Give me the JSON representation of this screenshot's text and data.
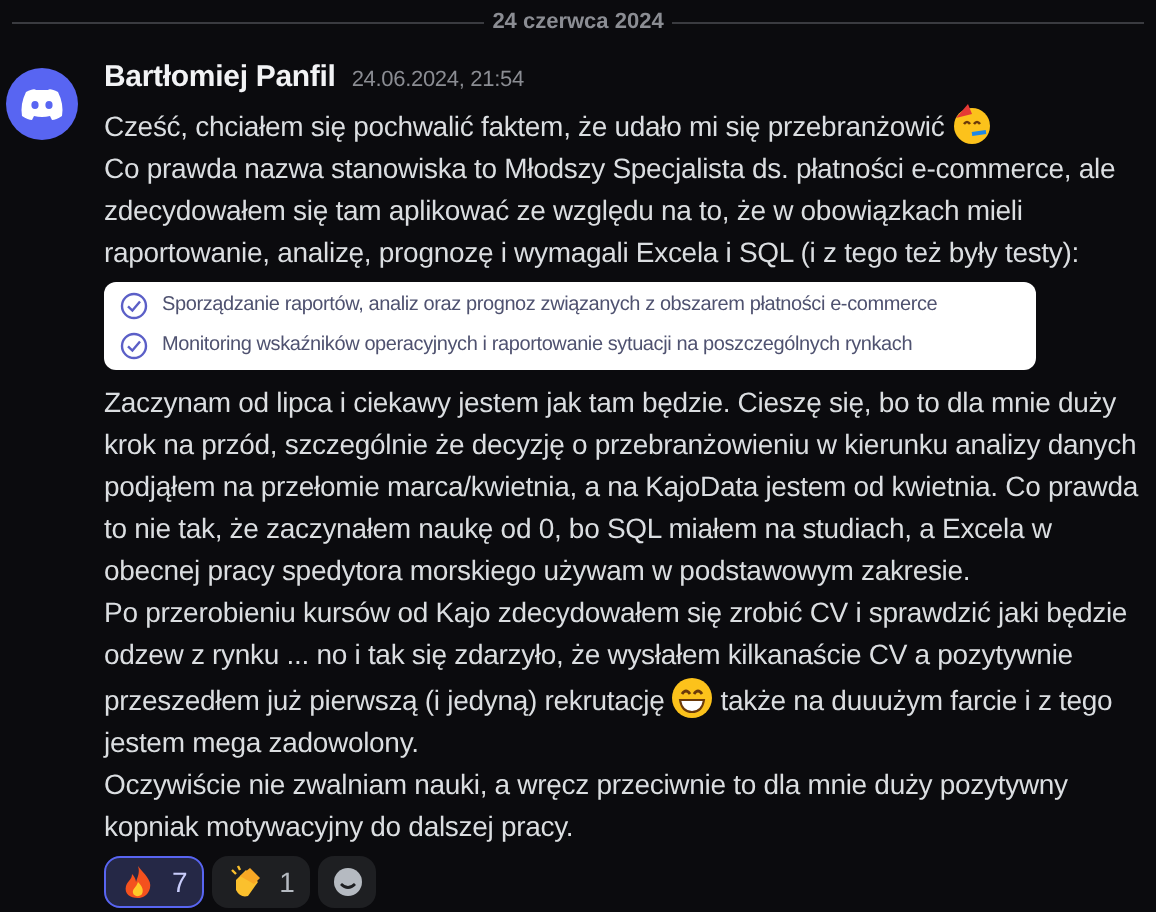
{
  "date_divider": "24 czerwca 2024",
  "message": {
    "author": "Bartłomiej Panfil",
    "timestamp": "24.06.2024, 21:54",
    "paragraphs_before": [
      [
        {
          "kind": "text",
          "text": "Cześć, chciałem się pochwalić faktem, że udało mi się przebranżowić"
        },
        {
          "kind": "party"
        }
      ],
      [
        {
          "kind": "text",
          "text": "Co prawda nazwa stanowiska to Młodszy Specjalista ds. płatności e-commerce, ale zdecydowałem się tam aplikować ze względu na to, że w obowiązkach mieli raportowanie, analizę, prognozę i wymagali Excela i SQL (i z tego też były testy):"
        }
      ]
    ],
    "attachment": {
      "items": [
        "Sporządzanie raportów, analiz oraz prognoz związanych z obszarem płatności e-commerce",
        "Monitoring wskaźników operacyjnych i raportowanie sytuacji na poszczególnych rynkach"
      ]
    },
    "paragraphs_after": [
      [
        {
          "kind": "text",
          "text": "Zaczynam od lipca i ciekawy jestem jak tam będzie. Cieszę się, bo to dla mnie duży krok na przód, szczególnie że decyzję o przebranżowieniu w kierunku analizy danych podjąłem na przełomie marca/kwietnia, a na KajoData jestem od kwietnia. Co prawda to nie tak, że zaczynałem naukę od 0, bo SQL miałem na studiach, a Excela w obecnej pracy spedytora morskiego używam w podstawowym zakresie."
        }
      ],
      [
        {
          "kind": "text",
          "text": "Po przerobieniu kursów od Kajo zdecydowałem się zrobić CV i sprawdzić jaki będzie odzew z rynku ... no i tak się zdarzyło, że wysłałem kilkanaście CV a pozytywnie"
        },
        {
          "kind": "inline",
          "text": "przeszedłem już pierwszą (i jedyną) rekrutację"
        },
        {
          "kind": "grin"
        },
        {
          "kind": "inline",
          "text": "także na duuużym farcie i z tego"
        },
        {
          "kind": "text",
          "text": "jestem mega zadowolony."
        }
      ],
      [
        {
          "kind": "text",
          "text": "Oczywiście nie zwalniam nauki, a wręcz przeciwnie to dla mnie duży pozytywny kopniak motywacyjny do dalszej pracy."
        }
      ]
    ],
    "reactions": [
      {
        "kind": "fire",
        "count": "7",
        "selected": true
      },
      {
        "kind": "clap",
        "count": "1",
        "selected": false
      }
    ]
  }
}
